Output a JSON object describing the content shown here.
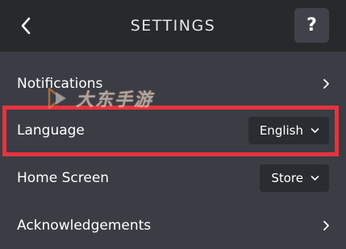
{
  "header": {
    "title": "SETTINGS",
    "help_label": "?"
  },
  "rows": [
    {
      "label": "Notifications"
    },
    {
      "label": "Language",
      "value": "English"
    },
    {
      "label": "Home Screen",
      "value": "Store"
    },
    {
      "label": "Acknowledgements"
    }
  ],
  "watermark": {
    "text": "大东手游"
  },
  "colors": {
    "header_bg": "#27292d",
    "page_bg": "#3a3d44",
    "dropdown_bg": "#2a2c31",
    "highlight_border": "#e8333d"
  },
  "icons": [
    "back-arrow",
    "help",
    "chevron-right",
    "chevron-down"
  ]
}
